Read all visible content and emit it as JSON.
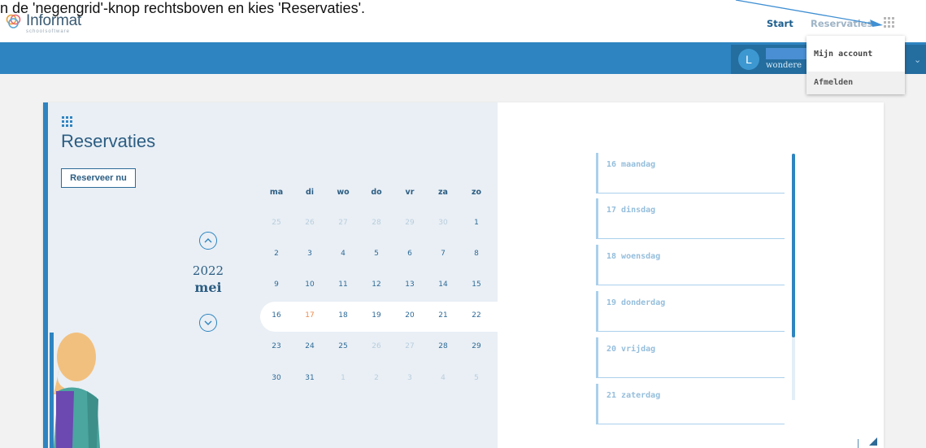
{
  "caption": "n de 'negengrid'-knop rechtsboven en kies 'Reservaties'.",
  "app": {
    "logo_name": "Informat",
    "logo_sub": "schoolsoftware"
  },
  "nav": {
    "start": "Start",
    "reservaties": "Reservaties"
  },
  "user": {
    "avatar_letter": "L",
    "name_part": "wondere"
  },
  "dropdown": {
    "items": [
      "Mijn account",
      "Afmelden"
    ]
  },
  "page": {
    "title": "Reservaties",
    "reserve_button": "Reserveer nu"
  },
  "calendar": {
    "year": "2022",
    "month": "mei",
    "weekdays": [
      "ma",
      "di",
      "wo",
      "do",
      "vr",
      "za",
      "zo"
    ],
    "weeks": [
      [
        "25",
        "26",
        "27",
        "28",
        "29",
        "30",
        "1"
      ],
      [
        "2",
        "3",
        "4",
        "5",
        "6",
        "7",
        "8"
      ],
      [
        "9",
        "10",
        "11",
        "12",
        "13",
        "14",
        "15"
      ],
      [
        "16",
        "17",
        "18",
        "19",
        "20",
        "21",
        "22"
      ],
      [
        "23",
        "24",
        "25",
        "26",
        "27",
        "28",
        "29"
      ],
      [
        "30",
        "31",
        "1",
        "2",
        "3",
        "4",
        "5"
      ]
    ],
    "selected_week_index": 3,
    "today": "17"
  },
  "week_list": [
    "16 maandag",
    "17 dinsdag",
    "18 woensdag",
    "19 donderdag",
    "20 vrijdag",
    "21 zaterdag"
  ],
  "colors": {
    "accent": "#2e84c0",
    "today": "#f08a4b",
    "bar": "#2e84c0"
  }
}
